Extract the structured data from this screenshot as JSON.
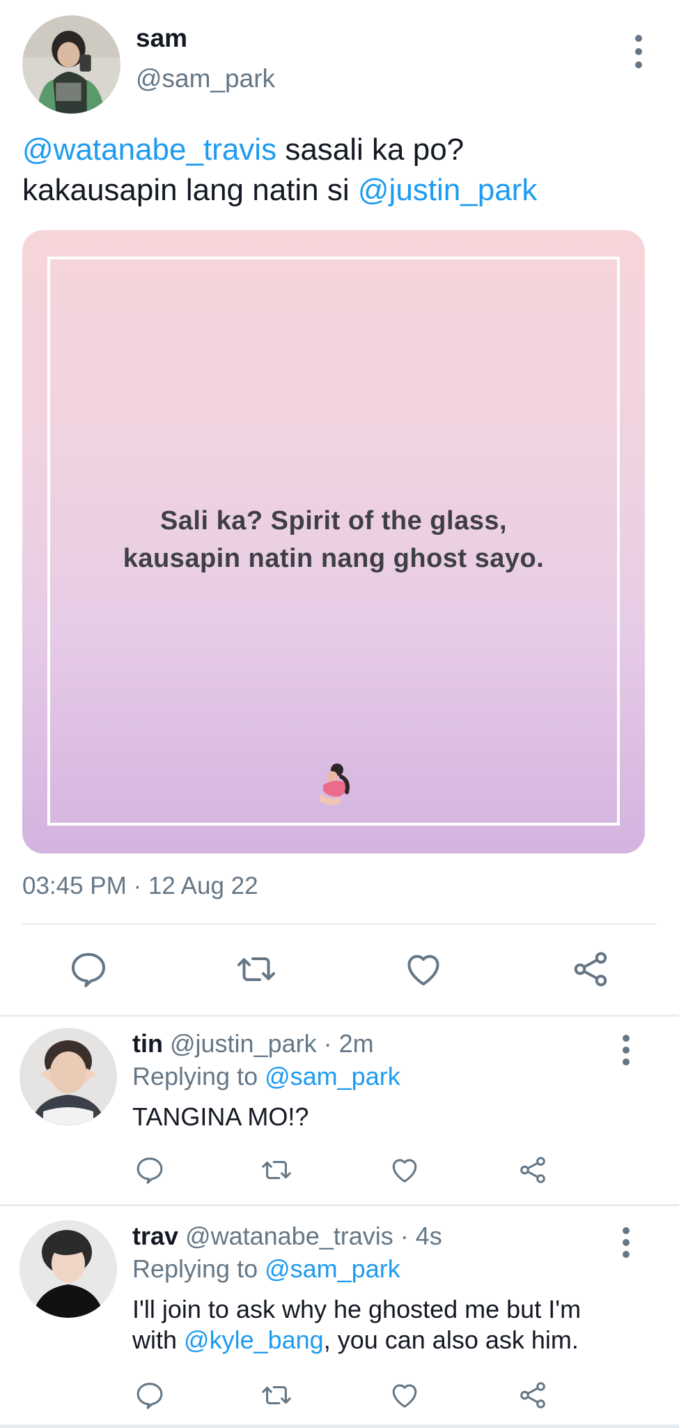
{
  "tweet": {
    "name": "sam",
    "handle": "@sam_park",
    "text_mention_1": "@watanabe_travis",
    "text_part_1": " sasali ka po?",
    "text_part_2": "kakausapin lang natin si ",
    "text_mention_2": "@justin_park",
    "image_caption_line1": "Sali ka? Spirit of the glass,",
    "image_caption_line2": "kausapin natin nang ghost sayo.",
    "timestamp": "03:45 PM · 12 Aug 22"
  },
  "replies": [
    {
      "name": "tin",
      "meta": " @justin_park · 2m",
      "replying_label": "Replying to ",
      "replying_handle": "@sam_park",
      "text": "TANGINA MO!?"
    },
    {
      "name": "trav",
      "meta": " @watanabe_travis · 4s",
      "replying_label": "Replying to ",
      "replying_handle": "@sam_park",
      "text_part_1": "I'll join to ask why he ghosted me but I'm",
      "text_part_2": "with ",
      "text_mention": "@kyle_bang",
      "text_part_3": ", you can also ask him."
    }
  ],
  "icons": [
    "more-vertical-icon",
    "reply-icon",
    "retweet-icon",
    "like-icon",
    "share-icon"
  ],
  "colors": {
    "accent": "#1d9bf0",
    "secondary_text": "#657786",
    "divider": "#e6ecf0"
  }
}
